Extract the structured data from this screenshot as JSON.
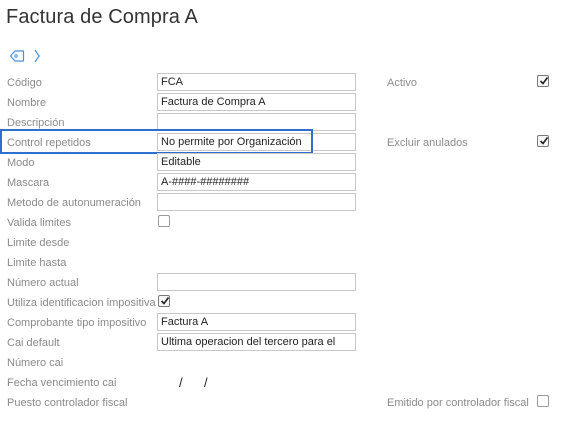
{
  "title": "Factura de Compra A",
  "toolbar": {
    "icons": [
      "tag-icon",
      "chevron-right-icon"
    ]
  },
  "accent_color": "#2f6fd0",
  "fields": {
    "codigo": {
      "label": "Código",
      "value": "FCA"
    },
    "nombre": {
      "label": "Nombre",
      "value": "Factura de Compra A"
    },
    "descripcion": {
      "label": "Descripción",
      "value": ""
    },
    "control_repetidos": {
      "label": "Control repetidos",
      "value": "No permite por Organización"
    },
    "modo": {
      "label": "Modo",
      "value": "Editable"
    },
    "mascara": {
      "label": "Mascara",
      "value": "A-####-########"
    },
    "metodo_autonumeracion": {
      "label": "Metodo de autonumeración",
      "value": ""
    },
    "valida_limites": {
      "label": "Valida limites",
      "checked": false
    },
    "limite_desde": {
      "label": "Limite desde"
    },
    "limite_hasta": {
      "label": "Limite hasta"
    },
    "numero_actual": {
      "label": "Número actual",
      "value": ""
    },
    "utiliza_identificacion": {
      "label": "Utiliza identificacion impositiva",
      "checked": true
    },
    "comprobante_tipo": {
      "label": "Comprobante tipo impositivo",
      "value": "Factura A"
    },
    "cai_default": {
      "label": "Cai default",
      "value": "Ultima operacion del tercero para el"
    },
    "numero_cai": {
      "label": "Número cai"
    },
    "fecha_vencimiento_cai": {
      "label": "Fecha vencimiento cai",
      "separator": "/"
    },
    "puesto_controlador": {
      "label": "Puesto controlador fiscal"
    }
  },
  "right_fields": {
    "activo": {
      "label": "Activo",
      "checked": true
    },
    "excluir_anulados": {
      "label": "Excluir anulados",
      "checked": true
    },
    "emitido_controlador": {
      "label": "Emitido por controlador fiscal",
      "checked": false
    }
  }
}
